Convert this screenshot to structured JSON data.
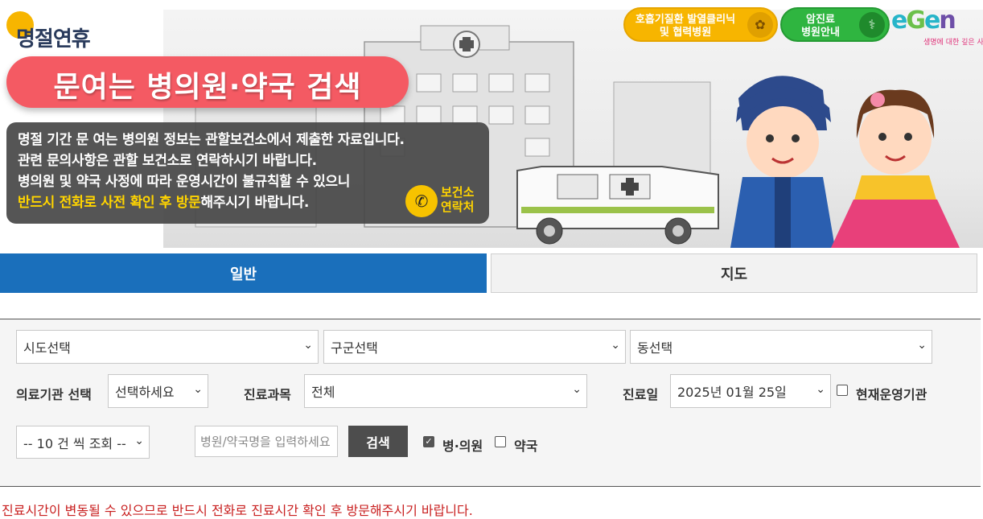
{
  "banner": {
    "logo_text": "명절연휴",
    "title": "문여는 병의원·약국 검색",
    "info_lines": [
      "명절 기간 문 여는 병의원 정보는 관할보건소에서 제출한 자료입니다.",
      "관련 문의사항은 관할 보건소로 연락하시기 바랍니다.",
      "병의원 및 약국 사정에 따라 운영시간이 불규칙할 수 있으니"
    ],
    "info_last_highlight": "반드시 전화로 사전 확인 후 방문",
    "info_last_rest": "해주시기 바랍니다.",
    "call_label_1": "보건소",
    "call_label_2": "연락처",
    "btn_clinic_1": "호흡기질환 발열클리닉",
    "btn_clinic_2": "및 협력병원",
    "btn_cancer_1": "암진료",
    "btn_cancer_2": "병원안내",
    "egen_letters": "eGen",
    "egen_sub": "생명에 대한 깊은 사랑"
  },
  "tabs": {
    "general": "일반",
    "map": "지도"
  },
  "search": {
    "sido": "시도선택",
    "gugun": "구군선택",
    "dong": "동선택",
    "org_label": "의료기관 선택",
    "org_value": "선택하세요",
    "dept_label": "진료과목",
    "dept_value": "전체",
    "date_label": "진료일",
    "date_value": "2025년 01월 25일",
    "open_now_label": "현재운영기관",
    "page_size": "-- 10 건 씩 조회 --",
    "name_placeholder": "병원/약국명을 입력하세요",
    "search_button": "검색",
    "hospital_label": "병·의원",
    "pharmacy_label": "약국",
    "hospital_checked": true,
    "pharmacy_checked": false,
    "open_now_checked": false
  },
  "notice": "진료시간이 변동될 수 있으므로 반드시 전화로 진료시간 확인 후 방문해주시기 바랍니다.",
  "colors": {
    "tab_active": "#1a6fbb",
    "title_pill": "#f45a63",
    "notice": "#c81e1e",
    "highlight": "#ffd400"
  },
  "icons": [
    "phone-icon",
    "lungs-icon",
    "stethoscope-icon",
    "chevron-down-icon",
    "checkbox-icon"
  ]
}
